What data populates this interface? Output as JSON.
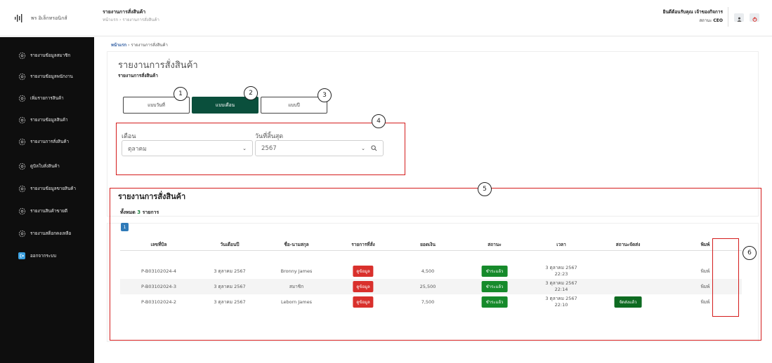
{
  "app": {
    "brand": "พร อิเล็กทรอนิกส์"
  },
  "header": {
    "title": "รายงานการสั่งสินค้า",
    "subtitle": "หน้าแรก › รายงานการสั่งสินค้า",
    "welcome": "ยินดีต้อนรับคุณ เจ้าของกิจการ",
    "status_label": "สถานะ",
    "status_value": "CEO"
  },
  "sidebar": {
    "items": [
      {
        "label": "รายงานข้อมูลสมาชิก",
        "icon": "settings-cog-icon"
      },
      {
        "label": "รายงานข้อมูลพนักงาน",
        "icon": "settings-cog-icon"
      },
      {
        "label": "เพิ่มรายการสินค้า",
        "icon": "settings-cog-icon"
      },
      {
        "label": "รายงานข้อมูลสินค้า",
        "icon": "settings-cog-icon"
      },
      {
        "label": "รายงานการสั่งสินค้า",
        "icon": "settings-cog-icon"
      },
      {
        "label": "ดูบิลใบสั่งสินค้า",
        "icon": "settings-cog-icon"
      },
      {
        "label": "รายงานข้อมูลขายสินค้า",
        "icon": "settings-cog-icon"
      },
      {
        "label": "รายงานสินค้าขายดี",
        "icon": "settings-cog-icon"
      },
      {
        "label": "รายงานสต็อกคงเหลือ",
        "icon": "settings-cog-icon"
      }
    ],
    "logout": "ออกจากระบบ"
  },
  "breadcrumb": {
    "home": "หน้าแรก",
    "current": "รายงานการสั่งสินค้า"
  },
  "page": {
    "title": "รายงานการสั่งสินค้า",
    "subtitle": "รายงานการสั่งสินค้า",
    "modes": [
      "แบบวันที่",
      "แบบเดือน",
      "แบบปี"
    ],
    "active_mode": "แบบเดือน"
  },
  "filter": {
    "month_label": "เดือน",
    "month_value": "ตุลาคม",
    "year_label": "วันที่สิ้นสุด",
    "year_value": "2567"
  },
  "report": {
    "title": "รายงานการสั่งสินค้า",
    "total_prefix": "ทั้งหมด",
    "total_count": "3",
    "total_suffix": "รายการ",
    "page": "1",
    "columns": [
      "เลขที่บิล",
      "วันเดือนปี",
      "ชื่อ-นามสกุล",
      "รายการที่สั่ง",
      "ยอดเงิน",
      "สถานะ",
      "เวลา",
      "สถานะจัดส่ง",
      "พิมพ์"
    ],
    "rows": [
      {
        "bill": "P-B03102024-4",
        "date": "3 ตุลาคม 2567",
        "name": "Bronny James",
        "items": "ดูข้อมูล",
        "amount": "4,500",
        "status": "ชำระแล้ว",
        "time_date": "3 ตุลาคม 2567",
        "time_clock": "22:23",
        "delivery": "",
        "print": "พิมพ์"
      },
      {
        "bill": "P-B03102024-3",
        "date": "3 ตุลาคม 2567",
        "name": "สมาชิก",
        "items": "ดูข้อมูล",
        "amount": "25,500",
        "status": "ชำระแล้ว",
        "time_date": "3 ตุลาคม 2567",
        "time_clock": "22:14",
        "delivery": "",
        "print": "พิมพ์"
      },
      {
        "bill": "P-B03102024-2",
        "date": "3 ตุลาคม 2567",
        "name": "Leborn James",
        "items": "ดูข้อมูล",
        "amount": "7,500",
        "status": "ชำระแล้ว",
        "time_date": "3 ตุลาคม 2567",
        "time_clock": "22:10",
        "delivery": "จัดส่งแล้ว",
        "print": "พิมพ์"
      }
    ]
  },
  "annotations": [
    "1",
    "2",
    "3",
    "4",
    "5",
    "6"
  ],
  "colors": {
    "accent_green": "#0a4f3c",
    "badge_red": "#d9302c",
    "badge_green": "#168a2b",
    "annotation_red": "#d41c1c",
    "sidebar_bg": "#0e0e0e"
  }
}
